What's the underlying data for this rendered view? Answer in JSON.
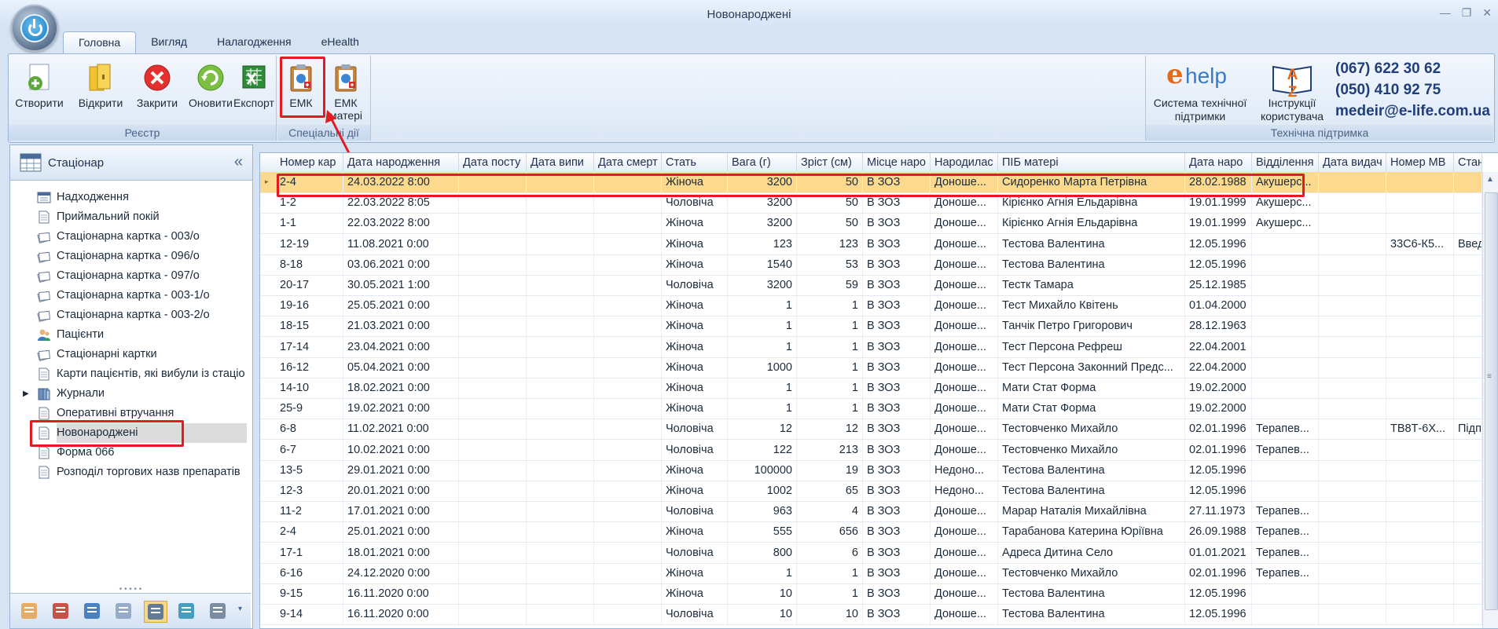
{
  "window": {
    "title": "Новонароджені",
    "controls": [
      "—",
      "❐",
      "✕"
    ]
  },
  "tabs": [
    {
      "label": "Головна",
      "active": true
    },
    {
      "label": "Вигляд",
      "active": false
    },
    {
      "label": "Налагодження",
      "active": false
    },
    {
      "label": "eHealth",
      "active": false
    }
  ],
  "ribbon": {
    "groups": [
      {
        "label": "Реєстр",
        "buttons": [
          {
            "label": "Створити",
            "icon": "create-document-icon"
          },
          {
            "label": "Відкрити",
            "icon": "open-folder-icon"
          },
          {
            "label": "Закрити",
            "icon": "close-circle-icon"
          },
          {
            "label": "Оновити",
            "icon": "refresh-icon"
          },
          {
            "label": "Експорт",
            "icon": "export-excel-icon"
          }
        ]
      },
      {
        "label": "Спеціальні дії",
        "buttons": [
          {
            "label": "ЕМК",
            "icon": "emk-clipboard-icon",
            "highlighted": true
          },
          {
            "label": "ЕМК",
            "label2": "матері",
            "icon": "emk-mother-clipboard-icon"
          }
        ]
      },
      {
        "label": "Технічна підтримка",
        "buttons": [
          {
            "label": "Система технічної",
            "label2": "підтримки",
            "icon": "ehelp-logo",
            "logo_text": "help",
            "logo_e": "e"
          },
          {
            "label": "Інструкції",
            "label2": "користувача",
            "icon": "a-z-book-icon",
            "logo_text": "A Z"
          }
        ]
      }
    ],
    "contacts": {
      "phone1": "(067) 622 30 62",
      "phone2": "(050) 410 92 75",
      "email": "medeir@e-life.com.ua"
    }
  },
  "left_panel": {
    "title": "Стаціонар",
    "collapse": "«",
    "items": [
      {
        "label": "Надходження",
        "icon": "register-icon"
      },
      {
        "label": "Приймальний покій",
        "icon": "document-icon"
      },
      {
        "label": "Стаціонарна картка - 003/о",
        "icon": "card-stack-icon"
      },
      {
        "label": "Стаціонарна картка - 096/о",
        "icon": "card-stack-icon"
      },
      {
        "label": "Стаціонарна картка - 097/о",
        "icon": "card-stack-icon"
      },
      {
        "label": "Стаціонарна картка - 003-1/о",
        "icon": "card-stack-icon"
      },
      {
        "label": "Стаціонарна картка - 003-2/о",
        "icon": "card-stack-icon"
      },
      {
        "label": "Пацієнти",
        "icon": "patients-icon"
      },
      {
        "label": "Стаціонарні картки",
        "icon": "card-stack-icon"
      },
      {
        "label": "Карти пацієнтів, які вибули із стаціо",
        "icon": "document-icon"
      },
      {
        "label": "Журнали",
        "icon": "journal-icon",
        "expandable": true
      },
      {
        "label": "Оперативні втручання",
        "icon": "document-icon"
      },
      {
        "label": "Новонароджені",
        "icon": "document-icon",
        "selected": true
      },
      {
        "label": "Форма 066",
        "icon": "document-icon"
      },
      {
        "label": "Розподіл торгових назв препаратів",
        "icon": "document-icon"
      }
    ],
    "bottom_icons": [
      "doctor-icon",
      "books-icon",
      "network-icon",
      "document-list-icon",
      "table-grid-icon",
      "caduceus-icon",
      "house-icon"
    ]
  },
  "grid": {
    "columns": [
      "Номер кар",
      "Дата народження",
      "Дата посту",
      "Дата випи",
      "Дата смерт",
      "Стать",
      "Вага (г)",
      "Зріст (см)",
      "Місце наро",
      "Народилас",
      "ПІБ матері",
      "Дата наро",
      "Відділення",
      "Дата видач",
      "Номер МВ",
      "Стан"
    ],
    "rows": [
      [
        "2-4",
        "24.03.2022 8:00",
        "",
        "",
        "",
        "Жіноча",
        "3200",
        "50",
        "В ЗОЗ",
        "Доноше...",
        "Сидоренко Марта Петрівна",
        "28.02.1988",
        "Акушерс...",
        "",
        "",
        ""
      ],
      [
        "1-2",
        "22.03.2022 8:05",
        "",
        "",
        "",
        "Чоловіча",
        "3200",
        "50",
        "В ЗОЗ",
        "Доноше...",
        "Кірієнко Агнія Ельдарівна",
        "19.01.1999",
        "Акушерс...",
        "",
        "",
        ""
      ],
      [
        "1-1",
        "22.03.2022 8:00",
        "",
        "",
        "",
        "Жіноча",
        "3200",
        "50",
        "В ЗОЗ",
        "Доноше...",
        "Кірієнко Агнія Ельдарівна",
        "19.01.1999",
        "Акушерс...",
        "",
        "",
        ""
      ],
      [
        "12-19",
        "11.08.2021 0:00",
        "",
        "",
        "",
        "Жіноча",
        "123",
        "123",
        "В ЗОЗ",
        "Доноше...",
        "Тестова Валентина",
        "12.05.1996",
        "",
        "",
        "33С6-К5...",
        "Введ"
      ],
      [
        "8-18",
        "03.06.2021 0:00",
        "",
        "",
        "",
        "Жіноча",
        "1540",
        "53",
        "В ЗОЗ",
        "Доноше...",
        "Тестова Валентина",
        "12.05.1996",
        "",
        "",
        "",
        ""
      ],
      [
        "20-17",
        "30.05.2021 1:00",
        "",
        "",
        "",
        "Чоловіча",
        "3200",
        "59",
        "В ЗОЗ",
        "Доноше...",
        "Тестк Тамара",
        "25.12.1985",
        "",
        "",
        "",
        ""
      ],
      [
        "19-16",
        "25.05.2021 0:00",
        "",
        "",
        "",
        "Жіноча",
        "1",
        "1",
        "В ЗОЗ",
        "Доноше...",
        "Тест Михайло Квітень",
        "01.04.2000",
        "",
        "",
        "",
        ""
      ],
      [
        "18-15",
        "21.03.2021 0:00",
        "",
        "",
        "",
        "Жіноча",
        "1",
        "1",
        "В ЗОЗ",
        "Доноше...",
        "Танчік Петро Григорович",
        "28.12.1963",
        "",
        "",
        "",
        ""
      ],
      [
        "17-14",
        "23.04.2021 0:00",
        "",
        "",
        "",
        "Жіноча",
        "1",
        "1",
        "В ЗОЗ",
        "Доноше...",
        "Тест Персона Рефреш",
        "22.04.2001",
        "",
        "",
        "",
        ""
      ],
      [
        "16-12",
        "05.04.2021 0:00",
        "",
        "",
        "",
        "Жіноча",
        "1000",
        "1",
        "В ЗОЗ",
        "Доноше...",
        "Тест Персона Законний Предс...",
        "22.04.2000",
        "",
        "",
        "",
        ""
      ],
      [
        "14-10",
        "18.02.2021 0:00",
        "",
        "",
        "",
        "Жіноча",
        "1",
        "1",
        "В ЗОЗ",
        "Доноше...",
        "Мати Стат Форма",
        "19.02.2000",
        "",
        "",
        "",
        ""
      ],
      [
        "25-9",
        "19.02.2021 0:00",
        "",
        "",
        "",
        "Жіноча",
        "1",
        "1",
        "В ЗОЗ",
        "Доноше...",
        "Мати Стат Форма",
        "19.02.2000",
        "",
        "",
        "",
        ""
      ],
      [
        "6-8",
        "11.02.2021 0:00",
        "",
        "",
        "",
        "Чоловіча",
        "12",
        "12",
        "В ЗОЗ",
        "Доноше...",
        "Тестовченко Михайло",
        "02.01.1996",
        "Терапев...",
        "",
        "ТВ8Т-6Х...",
        "Підп"
      ],
      [
        "6-7",
        "10.02.2021 0:00",
        "",
        "",
        "",
        "Чоловіча",
        "122",
        "213",
        "В ЗОЗ",
        "Доноше...",
        "Тестовченко Михайло",
        "02.01.1996",
        "Терапев...",
        "",
        "",
        ""
      ],
      [
        "13-5",
        "29.01.2021 0:00",
        "",
        "",
        "",
        "Жіноча",
        "100000",
        "19",
        "В ЗОЗ",
        "Недоно...",
        "Тестова Валентина",
        "12.05.1996",
        "",
        "",
        "",
        ""
      ],
      [
        "12-3",
        "20.01.2021 0:00",
        "",
        "",
        "",
        "Жіноча",
        "1002",
        "65",
        "В ЗОЗ",
        "Недоно...",
        "Тестова Валентина",
        "12.05.1996",
        "",
        "",
        "",
        ""
      ],
      [
        "11-2",
        "17.01.2021 0:00",
        "",
        "",
        "",
        "Чоловіча",
        "963",
        "4",
        "В ЗОЗ",
        "Доноше...",
        "Марар Наталія Михайлівна",
        "27.11.1973",
        "Терапев...",
        "",
        "",
        ""
      ],
      [
        "2-4",
        "25.01.2021 0:00",
        "",
        "",
        "",
        "Жіноча",
        "555",
        "656",
        "В ЗОЗ",
        "Доноше...",
        "Тарабанова Катерина Юріївна",
        "26.09.1988",
        "Терапев...",
        "",
        "",
        ""
      ],
      [
        "17-1",
        "18.01.2021 0:00",
        "",
        "",
        "",
        "Чоловіча",
        "800",
        "6",
        "В ЗОЗ",
        "Доноше...",
        "Адреса Дитина Село",
        "01.01.2021",
        "Терапев...",
        "",
        "",
        ""
      ],
      [
        "6-16",
        "24.12.2020 0:00",
        "",
        "",
        "",
        "Жіноча",
        "1",
        "1",
        "В ЗОЗ",
        "Доноше...",
        "Тестовченко Михайло",
        "02.01.1996",
        "Терапев...",
        "",
        "",
        ""
      ],
      [
        "9-15",
        "16.11.2020 0:00",
        "",
        "",
        "",
        "Жіноча",
        "10",
        "1",
        "В ЗОЗ",
        "Доноше...",
        "Тестова Валентина",
        "12.05.1996",
        "",
        "",
        "",
        ""
      ],
      [
        "9-14",
        "16.11.2020 0:00",
        "",
        "",
        "",
        "Чоловіча",
        "10",
        "10",
        "В ЗОЗ",
        "Доноше...",
        "Тестова Валентина",
        "12.05.1996",
        "",
        "",
        "",
        ""
      ]
    ],
    "selected_row": 0
  },
  "colors": {
    "accent": "#e21b23",
    "selected_row": "#fbd98e",
    "ribbon_bg": "#dbe7f6"
  }
}
